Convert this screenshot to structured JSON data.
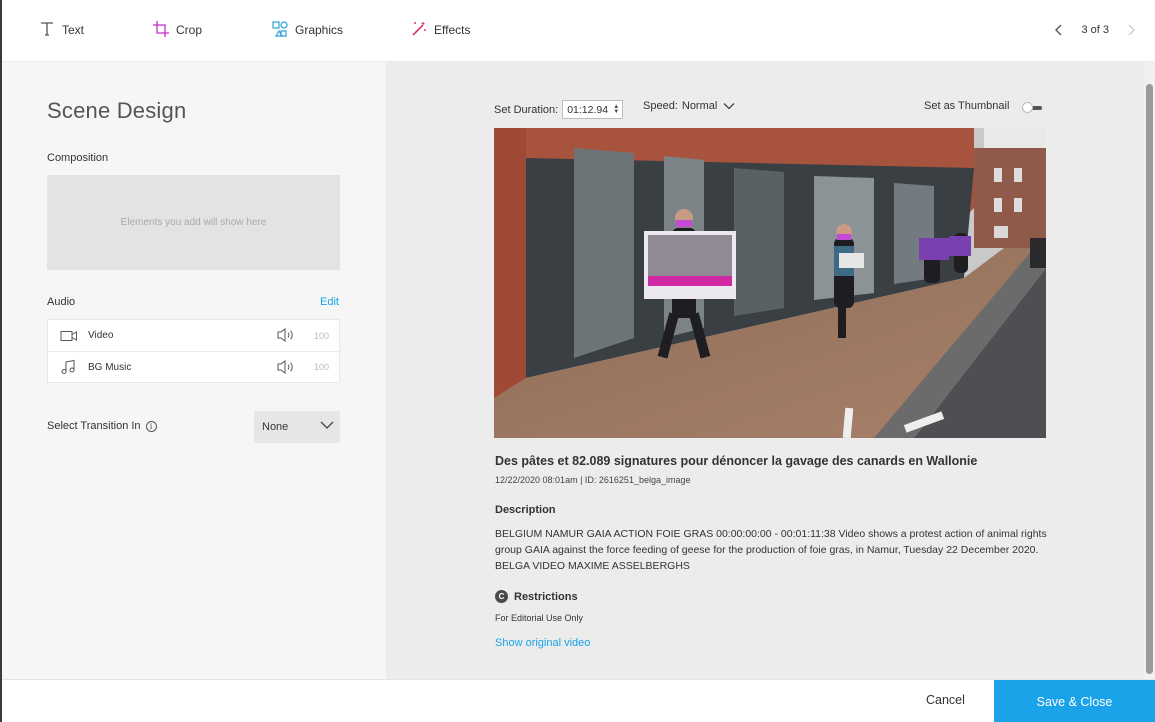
{
  "toolbar": {
    "tools": [
      {
        "label": "Text",
        "icon": "text-icon"
      },
      {
        "label": "Crop",
        "icon": "crop-icon"
      },
      {
        "label": "Graphics",
        "icon": "graphics-icon"
      },
      {
        "label": "Effects",
        "icon": "effects-icon"
      }
    ],
    "pager": {
      "text": "3 of 3",
      "prev_icon": "chevron-left-icon",
      "next_icon": "chevron-right-icon"
    }
  },
  "left_panel": {
    "title": "Scene Design",
    "composition_label": "Composition",
    "composition_placeholder": "Elements you add will show here",
    "audio_label": "Audio",
    "audio_edit": "Edit",
    "audio_tracks": [
      {
        "name": "Video",
        "icon": "video-camera-icon",
        "volume": "100"
      },
      {
        "name": "BG Music",
        "icon": "music-note-icon",
        "volume": "100"
      }
    ],
    "transition_label": "Select Transition In",
    "transition_info": "i",
    "transition_value": "None"
  },
  "right_panel": {
    "duration_label": "Set Duration:",
    "duration_value": "01:12.94",
    "speed_label": "Speed:",
    "speed_value": "Normal",
    "thumbnail_label": "Set as Thumbnail",
    "thumbnail_on": false,
    "video_title": "Des pâtes et 82.089 signatures pour dénoncer la gavage des canards en Wallonie",
    "video_meta": "12/22/2020 08:01am | ID: 2616251_belga_image",
    "description_label": "Description",
    "description_text": "BELGIUM NAMUR GAIA ACTION FOIE GRAS 00:00:00:00 - 00:01:11:38 Video shows a protest action of animal rights group GAIA against the force feeding of geese for the production of foie gras, in Namur, Tuesday 22 December 2020. BELGA VIDEO MAXIME ASSELBERGHS",
    "restrictions_icon": "C",
    "restrictions_label": "Restrictions",
    "restrictions_text": "For Editorial Use Only",
    "show_original": "Show original video"
  },
  "footer": {
    "cancel": "Cancel",
    "save": "Save & Close"
  },
  "colors": {
    "accent": "#1aa3e8",
    "crop_icon": "#c02ec9",
    "graphics_icon": "#2a9fd8",
    "effects_icon": "#e0336b"
  }
}
